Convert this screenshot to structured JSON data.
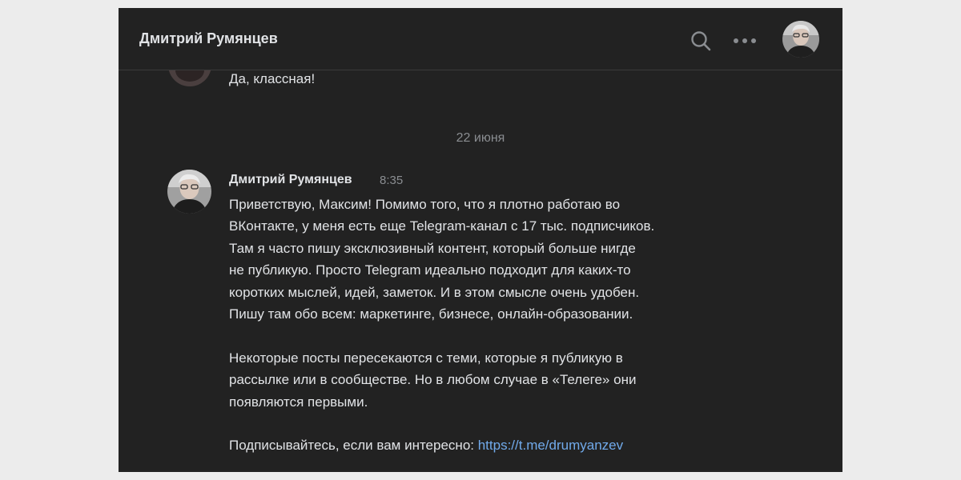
{
  "header": {
    "title": "Дмитрий Румянцев",
    "icons": [
      "search-icon",
      "more-icon",
      "avatar"
    ]
  },
  "previous_message": {
    "text": "Да, классная!"
  },
  "date_separator": "22 июня",
  "message": {
    "author": "Дмитрий Румянцев",
    "time": "8:35",
    "paragraph1": [
      "Приветствую, Максим! Помимо того, что я плотно работаю во",
      "ВКонтакте, у меня есть еще Telegram-канал с 17 тыс. подписчиков.",
      "Там я часто пишу эксклюзивный контент, который больше нигде",
      "не публикую. Просто Telegram идеально подходит для каких-то",
      "коротких мыслей, идей, заметок. И в этом смысле очень удобен.",
      "Пишу там обо всем: маркетинге, бизнесе, онлайн-образовании."
    ],
    "paragraph2": [
      "Некоторые посты пересекаются с теми, которые я публикую в",
      "рассылке или в сообществе. Но в любом случае в «Телеге» они",
      "появляются первыми."
    ],
    "cta_text": "Подписывайтесь, если вам интересно: ",
    "link_text": "https://t.me/drumyanzev"
  },
  "colors": {
    "background": "#222222",
    "page": "#ececec",
    "text": "#e1e3e6",
    "secondary_text": "#8a8d91",
    "link": "#71aaeb",
    "divider": "#3b3b3b"
  }
}
